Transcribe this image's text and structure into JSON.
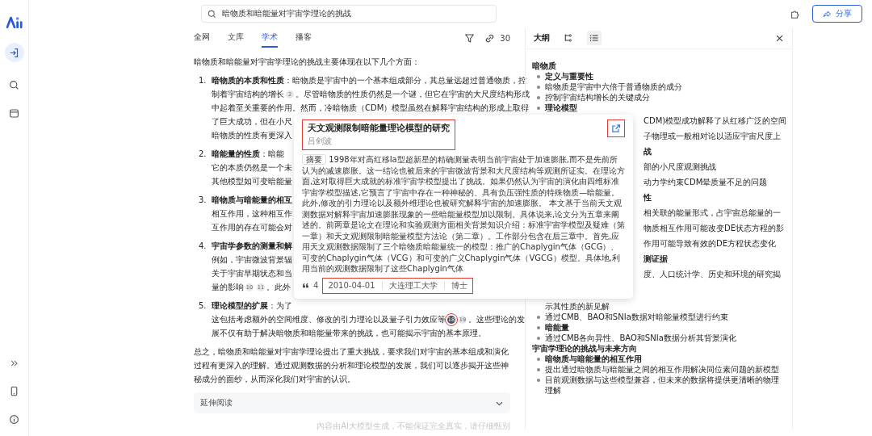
{
  "search": {
    "value": "暗物质和暗能量对宇宙学理论的挑战"
  },
  "share_button": {
    "label": "分享"
  },
  "tabs": [
    {
      "label": "全网",
      "selected": false
    },
    {
      "label": "文库",
      "selected": false
    },
    {
      "label": "学术",
      "selected": true
    },
    {
      "label": "播客",
      "selected": false
    }
  ],
  "source_count": "30",
  "article": {
    "intro": "暗物质和暗能量对宇宙学理论的挑战主要体现在以下几个方面：",
    "items": [
      {
        "number": "1.",
        "title": "暗物质的本质和性质",
        "first": [
          {
            "kind": "text",
            "text": "：暗物质是宇宙中的一个基本组成部分，其总量远超过普通物质，控"
          }
        ],
        "lines": [
          [
            {
              "kind": "text",
              "text": "制着宇宙结构的增长"
            },
            {
              "kind": "cite",
              "text": "2",
              "selected": false
            },
            {
              "kind": "text",
              "text": "。尽管暗物质的性质仍然是一个谜，但它在宇宙的大尺度结构形成"
            }
          ],
          [
            {
              "kind": "text",
              "text": "中起着至关重要的作用。然而，冷暗物质（CDM）模型虽然在解释宇宙结构的形成上取得"
            }
          ],
          [
            {
              "kind": "text",
              "text": "了巨大成功，但在小尺"
            }
          ],
          [
            {
              "kind": "text",
              "text": "暗物质的性质有更深入"
            }
          ]
        ]
      },
      {
        "number": "2.",
        "title": "暗能量的性质",
        "first": [
          {
            "kind": "text",
            "text": "：暗能"
          }
        ],
        "lines": [
          [
            {
              "kind": "text",
              "text": "它的本质仍然是一个未"
            }
          ],
          [
            {
              "kind": "text",
              "text": "其他模型如可变暗能量"
            }
          ]
        ]
      },
      {
        "number": "3.",
        "title": "暗物质与暗能量的相互",
        "lines": [
          [
            {
              "kind": "text",
              "text": "相互作用，这种相互作"
            }
          ],
          [
            {
              "kind": "text",
              "text": "互作用的存在可能会对"
            }
          ]
        ]
      },
      {
        "number": "4.",
        "title": "宇宙学参数的测量和解",
        "lines": [
          [
            {
              "kind": "text",
              "text": "例如，宇宙微波背景辐"
            }
          ],
          [
            {
              "kind": "text",
              "text": "关于宇宙早期状态和当"
            }
          ],
          [
            {
              "kind": "text",
              "text": "量的影响"
            },
            {
              "kind": "cite",
              "text": "10",
              "selected": false
            },
            {
              "kind": "cite",
              "text": "11",
              "selected": false
            },
            {
              "kind": "text",
              "text": "。此外，"
            }
          ]
        ]
      },
      {
        "number": "5.",
        "title": "理论模型的扩展",
        "first": [
          {
            "kind": "text",
            "text": "：为了"
          }
        ],
        "lines": [
          [
            {
              "kind": "text",
              "text": "这包括考虑额外的空间维度、修改的引力理论以及量子引力效应等"
            },
            {
              "kind": "cite",
              "text": "18",
              "selected": true
            },
            {
              "kind": "cite",
              "text": "19",
              "selected": false
            },
            {
              "kind": "text",
              "text": "。这些理论的发"
            }
          ],
          [
            {
              "kind": "text",
              "text": "展不仅有助于解决暗物质和暗能量带来的挑战，也可能揭示宇宙的基本原理。"
            }
          ]
        ]
      }
    ],
    "conclusion": "总之，暗物质和暗能量对宇宙学理论提出了重大挑战，要求我们对宇宙的基本组成和演化过程有更深入的理解。通过观测数据的分析和理论模型的发展，我们可以逐步揭开这些神秘成分的面纱，从而深化我们对宇宙的认识。",
    "further_reading": {
      "label": "延伸阅读",
      "expanded": false
    },
    "disclaimer": "内容由AI大模型生成，不能保证完全真实，请仔细甄别"
  },
  "popup": {
    "title": "天文观测限制暗能量理论模型的研究",
    "author": "吕剑波",
    "header_highlighted": true,
    "link_highlighted": true,
    "abstract_tag": "摘要",
    "abstract": "1998年对高红移Ⅰa型超新星的精确测量表明当前宇宙处于加速膨胀,而不是先前所认为的减速膨胀。这一结论也被后来的宇宙微波背景和大尺度结构等观测所证实。在理论方面,这对取得巨大成就的标准宇宙学模型提出了挑战。如果仍然认为宇宙的演化由四维标准宇宙学模型描述,它预言了宇宙中存在一种神秘的、具有负压强性质的特殊物质—暗能量。此外,修改的引力理论以及额外维理论也被研究解释宇宙的加速膨胀。 本文基于当前天文观测数据对解释宇宙加速膨胀现象的一些暗能量模型加以限制。具体说来,论文分为五章来阐述的。前两章是论文在理论和实验观测方面相关背景知识介绍：标准宇宙学模型及疑难（第一章）和天文观测限制暗能量模型方法论（第二章）。工作部分包含在后三章中。首先,应用天文观测数据限制了三个暗物质暗能量统一的模型：推广的Chaplygin气体（GCG）、可变的Chaplygin气体（VCG）和可变的广义Chaplygin气体（VGCG）模型。具体地,利用当前的观测数据限制了这些Chaplygin气体",
    "citations": "4",
    "date": "2010-04-01",
    "institution": "大连理工大学",
    "degree": "博士",
    "meta_highlighted": true
  },
  "outline": {
    "title": "大纲",
    "views": [
      {
        "kind": "mindmap",
        "selected": false
      },
      {
        "kind": "list",
        "selected": true
      }
    ],
    "items": [
      {
        "kind": "heading",
        "text": "暗物质"
      },
      {
        "kind": "bullet",
        "text": "定义与重要性",
        "bold": true
      },
      {
        "kind": "bullet",
        "text": "暗物质是宇宙中六倍于普通物质的成分",
        "bold": false
      },
      {
        "kind": "bullet",
        "text": "控制宇宙结构增长的关键成分",
        "bold": false
      },
      {
        "kind": "bullet",
        "text": "理论模型",
        "bold": true
      },
      {
        "kind": "fragment",
        "text": "CDM)模型成功解释了从红移广泛的空间",
        "bold": false
      },
      {
        "kind": "fragment",
        "text": "子物理或一般相对论以适应宇宙尺度上",
        "bold": false
      },
      {
        "kind": "fragment",
        "text": "战",
        "bold": true
      },
      {
        "kind": "fragment",
        "text": "部的小尺度观测挑战",
        "bold": false
      },
      {
        "kind": "fragment",
        "text": "动力学约束CDM晕质量不足的问题",
        "bold": false
      },
      {
        "kind": "fragment",
        "text": "性",
        "bold": true
      },
      {
        "kind": "fragment",
        "text": "相关联的能量形式，占宇宙总能量的一",
        "bold": false
      },
      {
        "kind": "fragment",
        "text": "物质相互作用可能改变DE状态方程的影",
        "bold": false
      },
      {
        "kind": "fragment",
        "text": "作用可能导致有效的DE方程状态变化",
        "bold": false
      },
      {
        "kind": "fragment",
        "text": "测证据",
        "bold": true
      },
      {
        "kind": "fragment",
        "text": "度、人口统计学、历史和环境的研究揭",
        "bold": false
      },
      {
        "kind": "continuation",
        "text": "示其性质的新见解",
        "bold": false
      },
      {
        "kind": "bullet",
        "text": "通过CMB、BAO和SNIa数据对暗能量模型进行约束",
        "bold": false
      },
      {
        "kind": "bullet",
        "text": "暗能量",
        "bold": true
      },
      {
        "kind": "bullet",
        "text": "通过CMB各向异性、BAO和SNIa数据分析其背景演化",
        "bold": false
      },
      {
        "kind": "heading",
        "text": "宇宙学理论的挑战与未来方向"
      },
      {
        "kind": "bullet",
        "text": "暗物质与暗能量的相互作用",
        "bold": true
      },
      {
        "kind": "bullet",
        "text": "提出通过暗物质与暗能量之间的相互作用解决同位素问题的新模型",
        "bold": false
      },
      {
        "kind": "bullet",
        "text": "目前观测数据与这些模型兼容，但未来的数据将提供更清晰的物理理解",
        "bold": false
      }
    ]
  }
}
